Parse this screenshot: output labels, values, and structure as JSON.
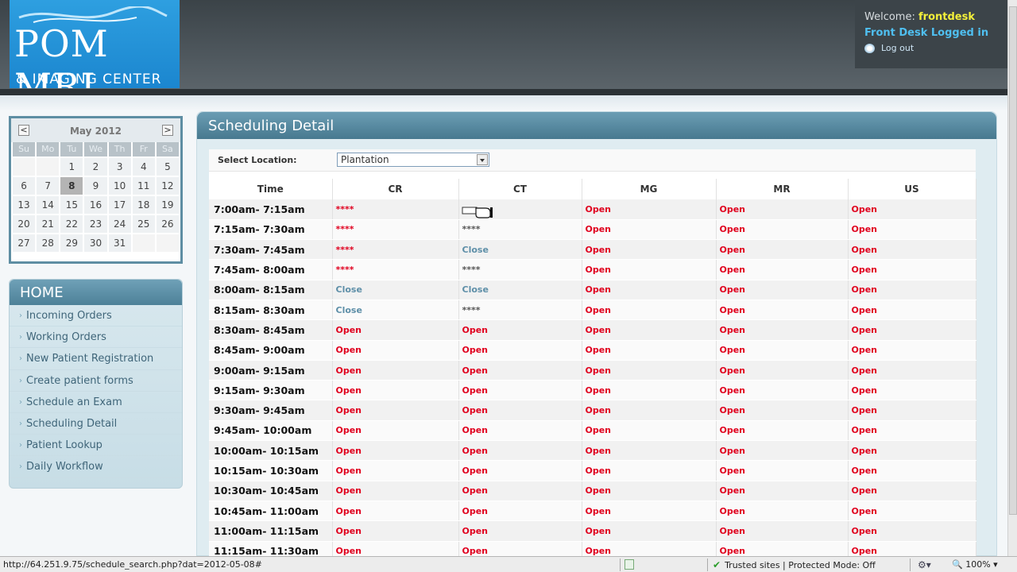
{
  "logo": {
    "line1": "POM MRI",
    "line2": "& IMAGING CENTER"
  },
  "user": {
    "welcome_prefix": "Welcome:",
    "username": "frontdesk",
    "logged_in": "Front Desk Logged in",
    "logout": "Log out"
  },
  "calendar": {
    "title": "May 2012",
    "prev": "<",
    "next": ">",
    "days_of_week": [
      "Su",
      "Mo",
      "Tu",
      "We",
      "Th",
      "Fr",
      "Sa"
    ],
    "weeks": [
      [
        "",
        "",
        "1",
        "2",
        "3",
        "4",
        "5"
      ],
      [
        "6",
        "7",
        "8",
        "9",
        "10",
        "11",
        "12"
      ],
      [
        "13",
        "14",
        "15",
        "16",
        "17",
        "18",
        "19"
      ],
      [
        "20",
        "21",
        "22",
        "23",
        "24",
        "25",
        "26"
      ],
      [
        "27",
        "28",
        "29",
        "30",
        "31",
        "",
        ""
      ]
    ],
    "selected": "8"
  },
  "home_menu": {
    "title": "HOME",
    "items": [
      "Incoming Orders",
      "Working Orders",
      "New Patient Registration",
      "Create patient forms",
      "Schedule an Exam",
      "Scheduling Detail",
      "Patient Lookup",
      "Daily Workflow"
    ]
  },
  "panel": {
    "title": "Scheduling Detail",
    "location_label": "Select Location:",
    "location_value": "Plantation"
  },
  "schedule": {
    "columns": [
      "Time",
      "CR",
      "CT",
      "MG",
      "MR",
      "US"
    ],
    "rows": [
      {
        "time": "7:00am- 7:15am",
        "cells": [
          "****",
          "",
          "Open",
          "Open",
          "Open"
        ]
      },
      {
        "time": "7:15am- 7:30am",
        "cells": [
          "****",
          "****",
          "Open",
          "Open",
          "Open"
        ]
      },
      {
        "time": "7:30am- 7:45am",
        "cells": [
          "****",
          "Close",
          "Open",
          "Open",
          "Open"
        ]
      },
      {
        "time": "7:45am- 8:00am",
        "cells": [
          "****",
          "****",
          "Open",
          "Open",
          "Open"
        ]
      },
      {
        "time": "8:00am- 8:15am",
        "cells": [
          "Close",
          "Close",
          "Open",
          "Open",
          "Open"
        ]
      },
      {
        "time": "8:15am- 8:30am",
        "cells": [
          "Close",
          "****",
          "Open",
          "Open",
          "Open"
        ]
      },
      {
        "time": "8:30am- 8:45am",
        "cells": [
          "Open",
          "Open",
          "Open",
          "Open",
          "Open"
        ]
      },
      {
        "time": "8:45am- 9:00am",
        "cells": [
          "Open",
          "Open",
          "Open",
          "Open",
          "Open"
        ]
      },
      {
        "time": "9:00am- 9:15am",
        "cells": [
          "Open",
          "Open",
          "Open",
          "Open",
          "Open"
        ]
      },
      {
        "time": "9:15am- 9:30am",
        "cells": [
          "Open",
          "Open",
          "Open",
          "Open",
          "Open"
        ]
      },
      {
        "time": "9:30am- 9:45am",
        "cells": [
          "Open",
          "Open",
          "Open",
          "Open",
          "Open"
        ]
      },
      {
        "time": "9:45am- 10:00am",
        "cells": [
          "Open",
          "Open",
          "Open",
          "Open",
          "Open"
        ]
      },
      {
        "time": "10:00am- 10:15am",
        "cells": [
          "Open",
          "Open",
          "Open",
          "Open",
          "Open"
        ]
      },
      {
        "time": "10:15am- 10:30am",
        "cells": [
          "Open",
          "Open",
          "Open",
          "Open",
          "Open"
        ]
      },
      {
        "time": "10:30am- 10:45am",
        "cells": [
          "Open",
          "Open",
          "Open",
          "Open",
          "Open"
        ]
      },
      {
        "time": "10:45am- 11:00am",
        "cells": [
          "Open",
          "Open",
          "Open",
          "Open",
          "Open"
        ]
      },
      {
        "time": "11:00am- 11:15am",
        "cells": [
          "Open",
          "Open",
          "Open",
          "Open",
          "Open"
        ]
      },
      {
        "time": "11:15am- 11:30am",
        "cells": [
          "Open",
          "Open",
          "Open",
          "Open",
          "Open"
        ]
      }
    ]
  },
  "status_bar": {
    "url": "http://64.251.9.75/schedule_search.php?dat=2012-05-08#",
    "zone": "Trusted sites | Protected Mode: Off",
    "zoom": "100%"
  }
}
